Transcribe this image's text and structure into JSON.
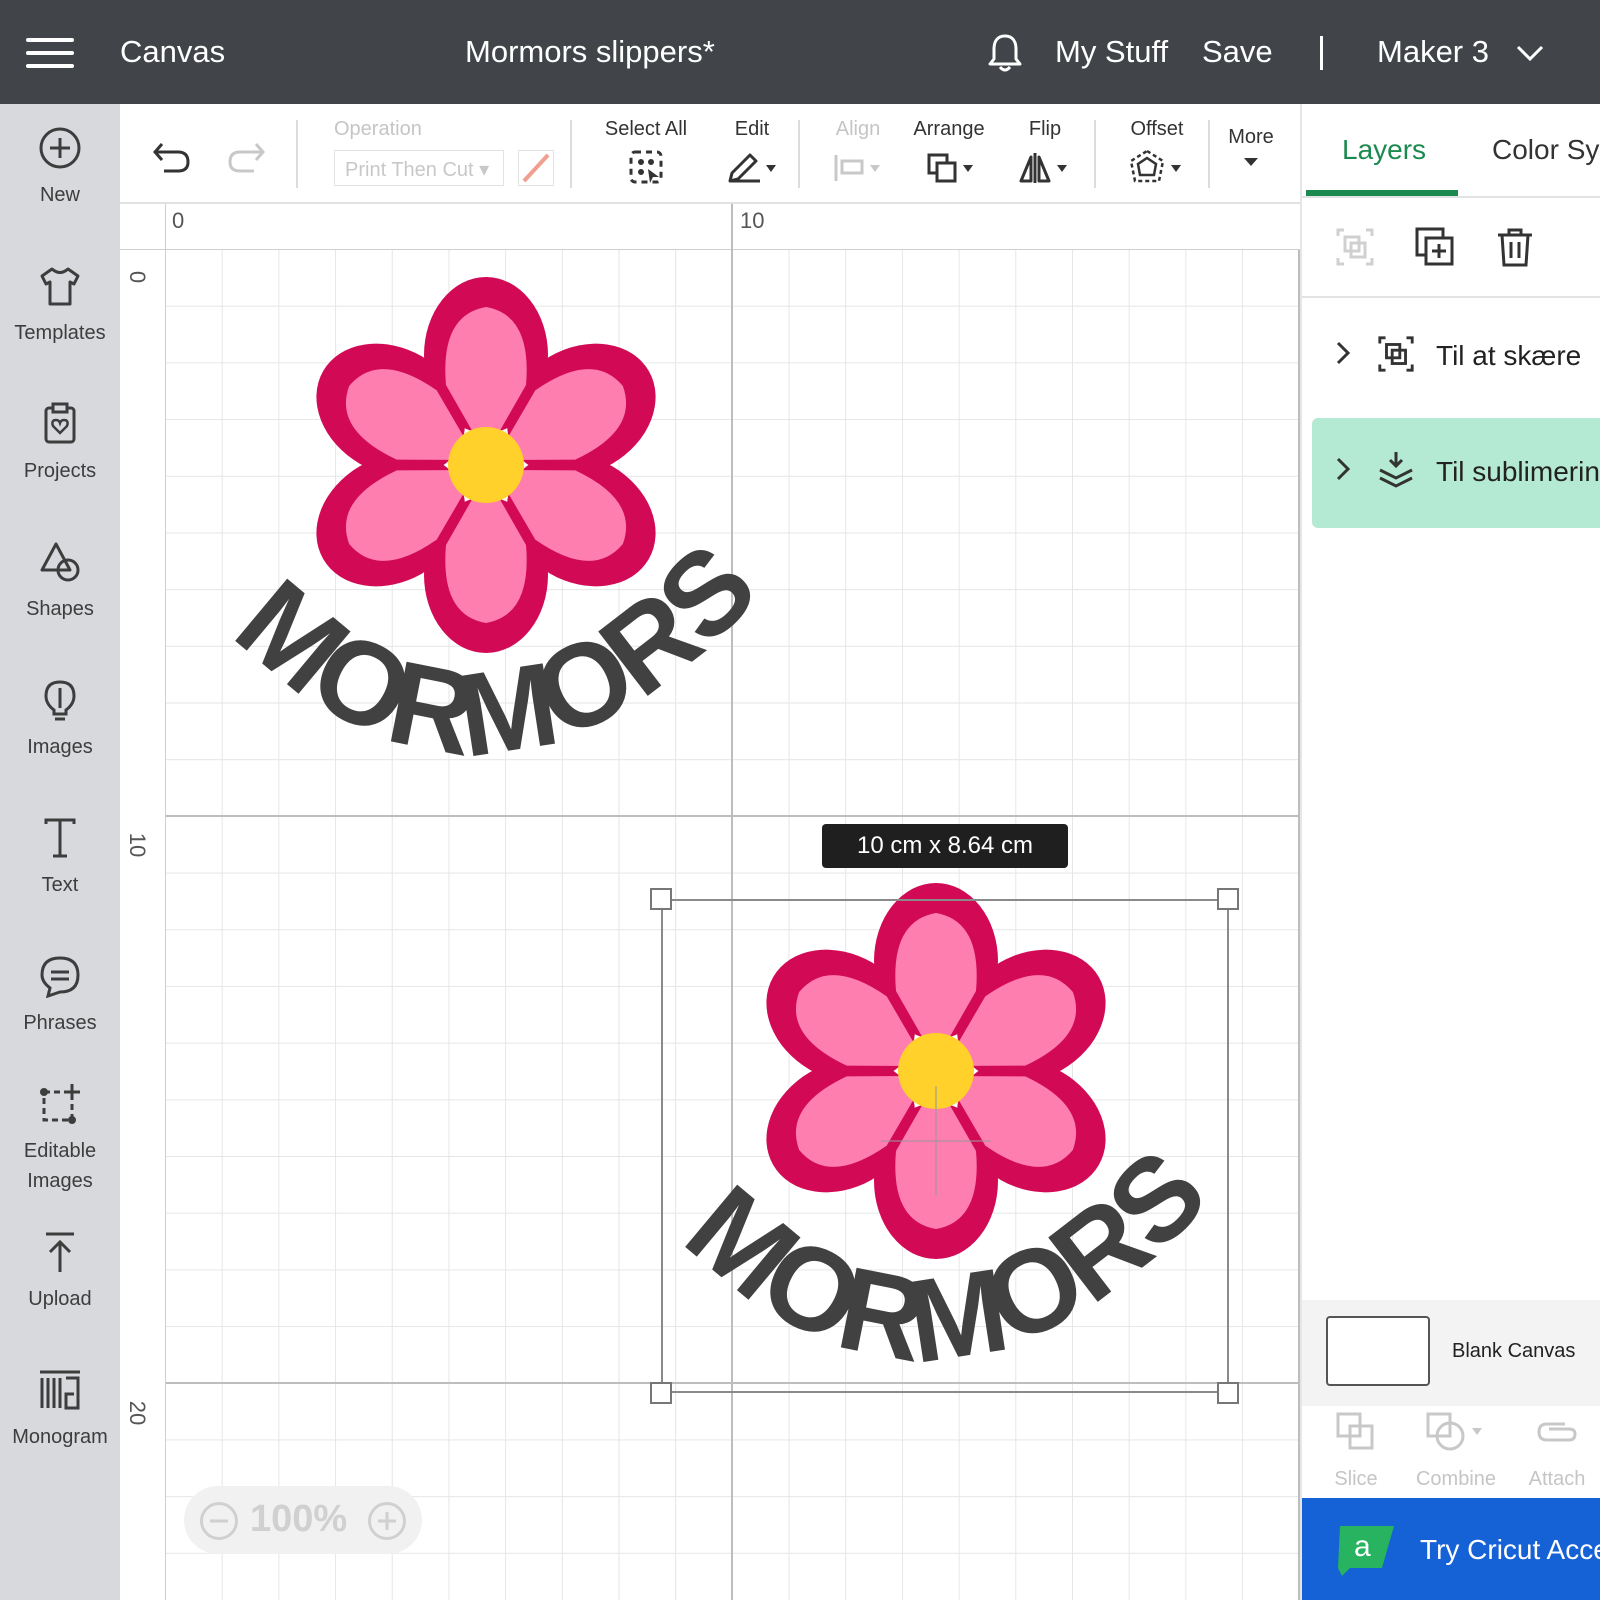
{
  "header": {
    "app_section": "Canvas",
    "project_title": "Mormors slippers*",
    "my_stuff": "My Stuff",
    "save": "Save",
    "divider": "|",
    "machine": "Maker 3"
  },
  "sidebar": {
    "items": [
      {
        "label": "New",
        "icon": "plus-circle-icon"
      },
      {
        "label": "Templates",
        "icon": "shirt-icon"
      },
      {
        "label": "Projects",
        "icon": "clipboard-heart-icon"
      },
      {
        "label": "Shapes",
        "icon": "shapes-icon"
      },
      {
        "label": "Images",
        "icon": "lightbulb-icon"
      },
      {
        "label": "Text",
        "icon": "text-icon"
      },
      {
        "label": "Phrases",
        "icon": "speech-bubble-icon"
      },
      {
        "label": "Editable",
        "label2": "Images",
        "icon": "editable-images-icon"
      },
      {
        "label": "Upload",
        "icon": "upload-icon"
      },
      {
        "label": "Monogram",
        "icon": "monogram-icon"
      }
    ]
  },
  "toolbar": {
    "operation_label": "Operation",
    "operation_value": "Print Then Cut",
    "select_all": "Select All",
    "edit": "Edit",
    "align": "Align",
    "arrange": "Arrange",
    "flip": "Flip",
    "offset": "Offset",
    "more": "More"
  },
  "canvas": {
    "ruler_x": [
      "0",
      "10"
    ],
    "ruler_y": [
      "0",
      "10",
      "20"
    ],
    "design_text": "MORMORS",
    "selection_size": "10  cm x 8.64  cm",
    "zoom": "100%"
  },
  "colors": {
    "petal_outer": "#d20a56",
    "petal_inner": "#ff7eb0",
    "center": "#ffd12a",
    "text": "#414141",
    "accent": "#1c8a4f"
  },
  "right_panel": {
    "tabs": [
      "Layers",
      "Color Sync"
    ],
    "layers": [
      {
        "name": "Til at skære",
        "icon": "group-icon"
      },
      {
        "name": "Til sublimering",
        "icon": "layers-download-icon"
      }
    ],
    "blank_canvas": "Blank Canvas",
    "bottom_tools": [
      "Slice",
      "Combine",
      "Attach"
    ],
    "promo": "Try Cricut Access"
  }
}
